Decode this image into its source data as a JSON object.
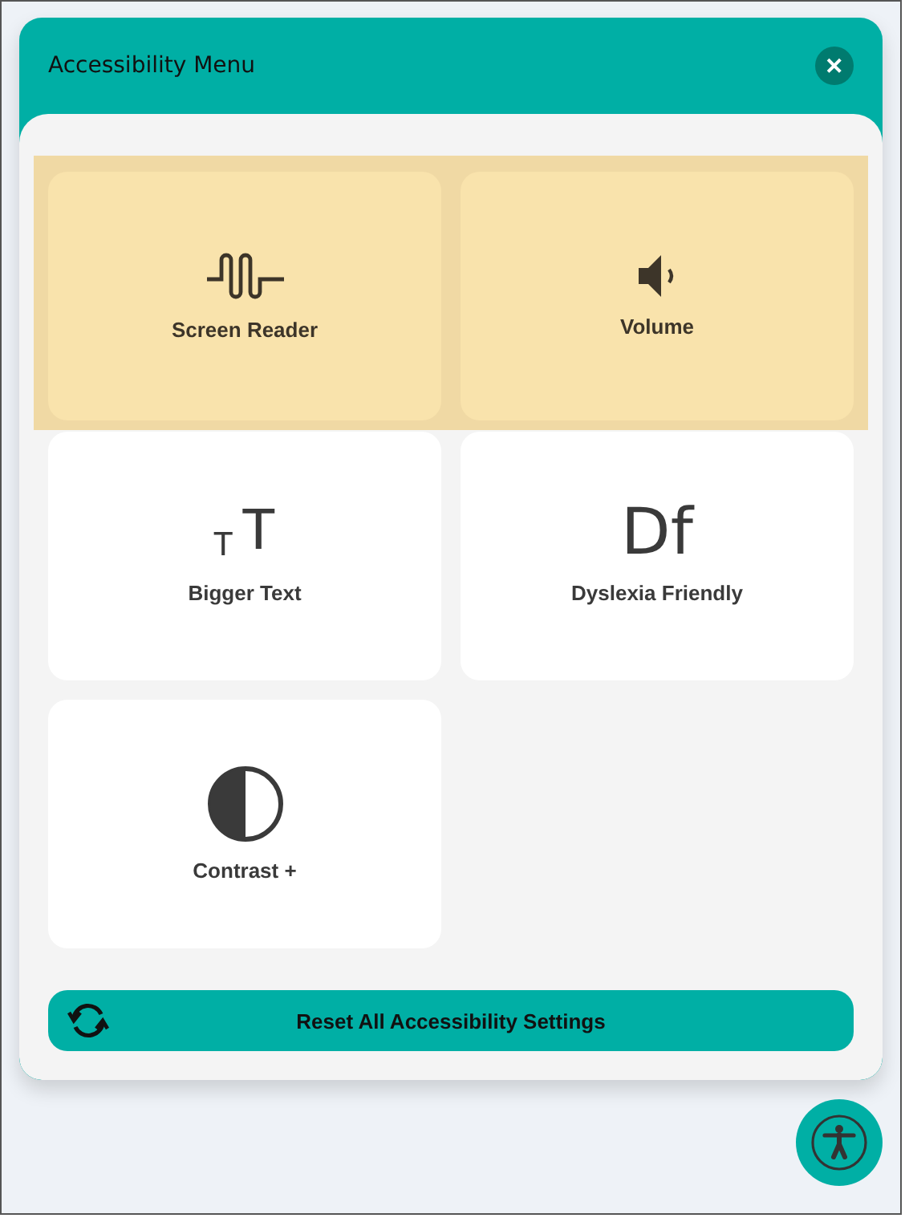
{
  "header": {
    "title": "Accessibility Menu",
    "close": "✕"
  },
  "rows": [
    {
      "tiles": [
        {
          "label": "Screen Reader",
          "kind": "wave",
          "active": true
        },
        {
          "label": "Volume",
          "kind": "speaker",
          "active": true
        }
      ]
    },
    {
      "tiles": [
        {
          "label": "Bigger Text",
          "kind": "glyph",
          "glyphs": [
            "T",
            "T"
          ],
          "active": false
        },
        {
          "label": "Dyslexia Friendly",
          "kind": "glyph",
          "glyphs": [
            "Df"
          ],
          "active": false
        }
      ]
    },
    {
      "tiles": [
        {
          "label": "Contrast +",
          "kind": "contrast",
          "active": false
        }
      ]
    }
  ],
  "reset_button": {
    "label": "Reset All Accessibility Settings"
  }
}
